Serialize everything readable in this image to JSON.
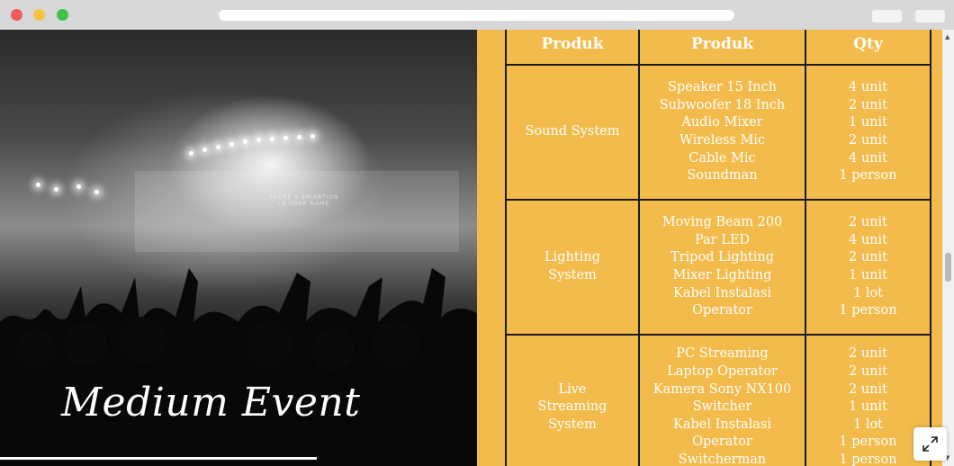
{
  "hero": {
    "title": "Medium Event",
    "screen_text_line1": "THERE'S SALVATION",
    "screen_text_line2": "IN YOUR NAME"
  },
  "table": {
    "headers": [
      "Produk",
      "Produk",
      "Qty"
    ],
    "rows": [
      {
        "category": "Sound System",
        "items": [
          "Speaker 15 Inch",
          "Subwoofer 18 Inch",
          "Audio Mixer",
          "Wireless Mic",
          "Cable Mic",
          "Soundman"
        ],
        "qty": [
          "4 unit",
          "2 unit",
          "1 unit",
          "2 unit",
          "4 unit",
          "1 person"
        ]
      },
      {
        "category": "Lighting System",
        "items": [
          "Moving Beam 200",
          "Par LED",
          "Tripod Lighting",
          "Mixer Lighting",
          "Kabel Instalasi",
          "Operator"
        ],
        "qty": [
          "2 unit",
          "4 unit",
          "2 unit",
          "1 unit",
          "1 lot",
          "1 person"
        ]
      },
      {
        "category": "Live Streaming System",
        "items": [
          "PC Streaming",
          "Laptop Operator",
          "Kamera Sony NX100",
          "Switcher",
          "Kabel Instalasi",
          "Operator",
          "Switcherman"
        ],
        "qty": [
          "2 unit",
          "2 unit",
          "2 unit",
          "1 unit",
          "1 lot",
          "1 person",
          "1 person"
        ]
      }
    ]
  },
  "colors": {
    "panel": "#f3bb4b",
    "border": "#1a1a1a",
    "text": "#ffffff"
  },
  "icons": {
    "expand": "expand-icon"
  }
}
